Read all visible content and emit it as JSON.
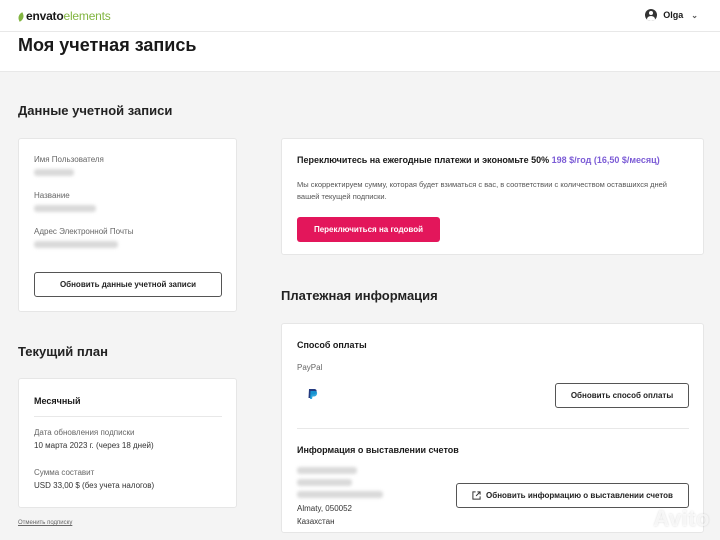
{
  "header": {
    "logo_part1": "envato",
    "logo_part2": "elements",
    "user_name": "Olga"
  },
  "page": {
    "title": "Моя учетная запись"
  },
  "account": {
    "heading": "Данные учетной записи",
    "username_label": "Имя Пользователя",
    "name_label": "Название",
    "email_label": "Адрес Электронной Почты",
    "update_button": "Обновить данные учетной записи"
  },
  "plan": {
    "heading": "Текущий план",
    "name": "Месячный",
    "renewal_label": "Дата обновления подписки",
    "renewal_value": "10 марта 2023 г. (через 18 дней)",
    "amount_label": "Сумма составит",
    "amount_value": "USD 33,00 $ (без учета налогов)",
    "cancel_link": "Отменить подписку"
  },
  "annual": {
    "headline": "Переключитесь на ежегодные платежи и экономьте 50%",
    "price": "198 $/год (16,50 $/месяц)",
    "description": "Мы скорректируем сумму, которая будет взиматься с вас, в соответствии с количеством оставшихся дней вашей текущей подписки.",
    "button": "Переключиться на годовой"
  },
  "payment": {
    "heading": "Платежная информация",
    "method_title": "Способ оплаты",
    "method_name": "PayPal",
    "update_method_button": "Обновить способ оплаты",
    "billing_title": "Информация о выставлении счетов",
    "city_line": "Almaty, 050052",
    "country": "Казахстан",
    "update_billing_button": "Обновить информацию о выставлении счетов"
  },
  "watermark": "Avito",
  "colors": {
    "brand_green": "#82b541",
    "primary_pink": "#e3165b",
    "accent_purple": "#7c5cd6"
  },
  "icons": {
    "user": "user-circle-icon",
    "chevron": "chevron-down-icon",
    "paypal": "paypal-icon",
    "external": "external-link-icon"
  }
}
